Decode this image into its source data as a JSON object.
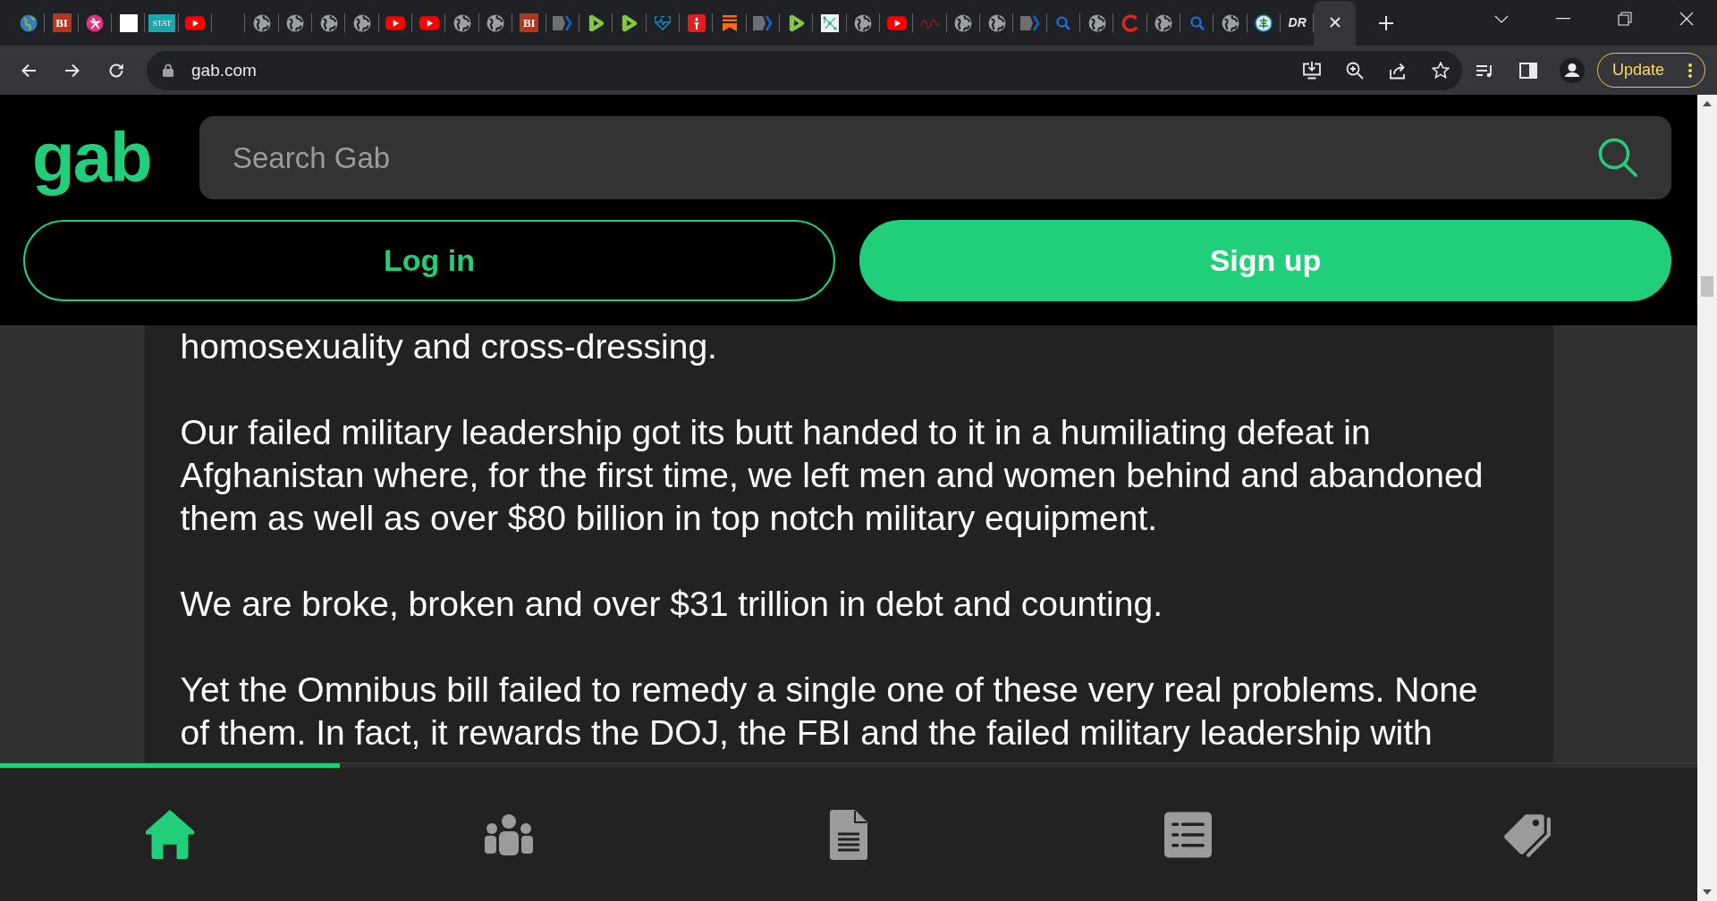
{
  "browser": {
    "tabs": [
      {
        "kind": "earth",
        "selected": false
      },
      {
        "kind": "monogram",
        "label": "BI",
        "color": "#b5371b",
        "selected": false
      },
      {
        "kind": "figure",
        "selected": false
      },
      {
        "kind": "square",
        "selected": false
      },
      {
        "kind": "monogram",
        "label": "STAT",
        "color": "#1fa3ac",
        "selected": false
      },
      {
        "kind": "video",
        "selected": false
      },
      {
        "selected": false
      },
      {
        "kind": "globe",
        "selected": false
      },
      {
        "kind": "globe",
        "selected": false
      },
      {
        "kind": "globe",
        "selected": false
      },
      {
        "kind": "globe",
        "selected": false
      },
      {
        "kind": "video",
        "selected": false
      },
      {
        "kind": "video",
        "selected": false
      },
      {
        "kind": "globe",
        "selected": false
      },
      {
        "kind": "globe",
        "selected": false
      },
      {
        "kind": "monogram",
        "label": "BI",
        "color": "#b5371b",
        "selected": false
      },
      {
        "kind": "chevron",
        "selected": false
      },
      {
        "kind": "play",
        "selected": false
      },
      {
        "kind": "play",
        "selected": false
      },
      {
        "kind": "heartbeat",
        "selected": false
      },
      {
        "kind": "torch",
        "selected": false
      },
      {
        "kind": "bookmark",
        "selected": false
      },
      {
        "kind": "chevron",
        "selected": false
      },
      {
        "kind": "play",
        "selected": false
      },
      {
        "kind": "network",
        "selected": false
      },
      {
        "kind": "globe",
        "selected": false
      },
      {
        "kind": "video",
        "selected": false
      },
      {
        "kind": "scribble",
        "selected": false
      },
      {
        "kind": "globe",
        "selected": false
      },
      {
        "kind": "globe",
        "selected": false
      },
      {
        "kind": "chevron",
        "selected": false
      },
      {
        "kind": "magnifier",
        "selected": false
      },
      {
        "kind": "globe",
        "selected": false
      },
      {
        "kind": "ring",
        "selected": false
      },
      {
        "kind": "globe",
        "selected": false
      },
      {
        "kind": "magnifier",
        "selected": false
      },
      {
        "kind": "globe",
        "selected": false
      },
      {
        "kind": "emblem",
        "selected": false
      },
      {
        "kind": "wordmark",
        "label": "DR",
        "selected": false
      },
      {
        "selected": true
      }
    ],
    "address": "gab.com",
    "update_label": "Update"
  },
  "header": {
    "logo": "gab",
    "search": {
      "placeholder": "Search Gab"
    },
    "buttons": [
      {
        "label": "Log in",
        "kind": "outline"
      },
      {
        "label": "Sign up",
        "kind": "filled"
      }
    ]
  },
  "post": {
    "paragraphs": [
      "homosexuality and cross-dressing.",
      "Our failed military leadership got its butt handed to it in a humiliating defeat in Afghanistan where, for the first time, we left men and women behind and abandoned them as well as over $80 billion in top notch military equipment.",
      "We are broke, broken and over $31 trillion in debt and counting.",
      "Yet the Omnibus bill failed to remedy a single one of these very real problems. None of them. In fact, it rewards the DOJ, the FBI and the failed military leadership with"
    ]
  },
  "bottom_nav": {
    "progress": {
      "level": 0.2
    },
    "items": [
      {
        "selected": true
      },
      {
        "selected": false
      },
      {
        "selected": false
      },
      {
        "selected": false
      },
      {
        "selected": false
      }
    ]
  }
}
